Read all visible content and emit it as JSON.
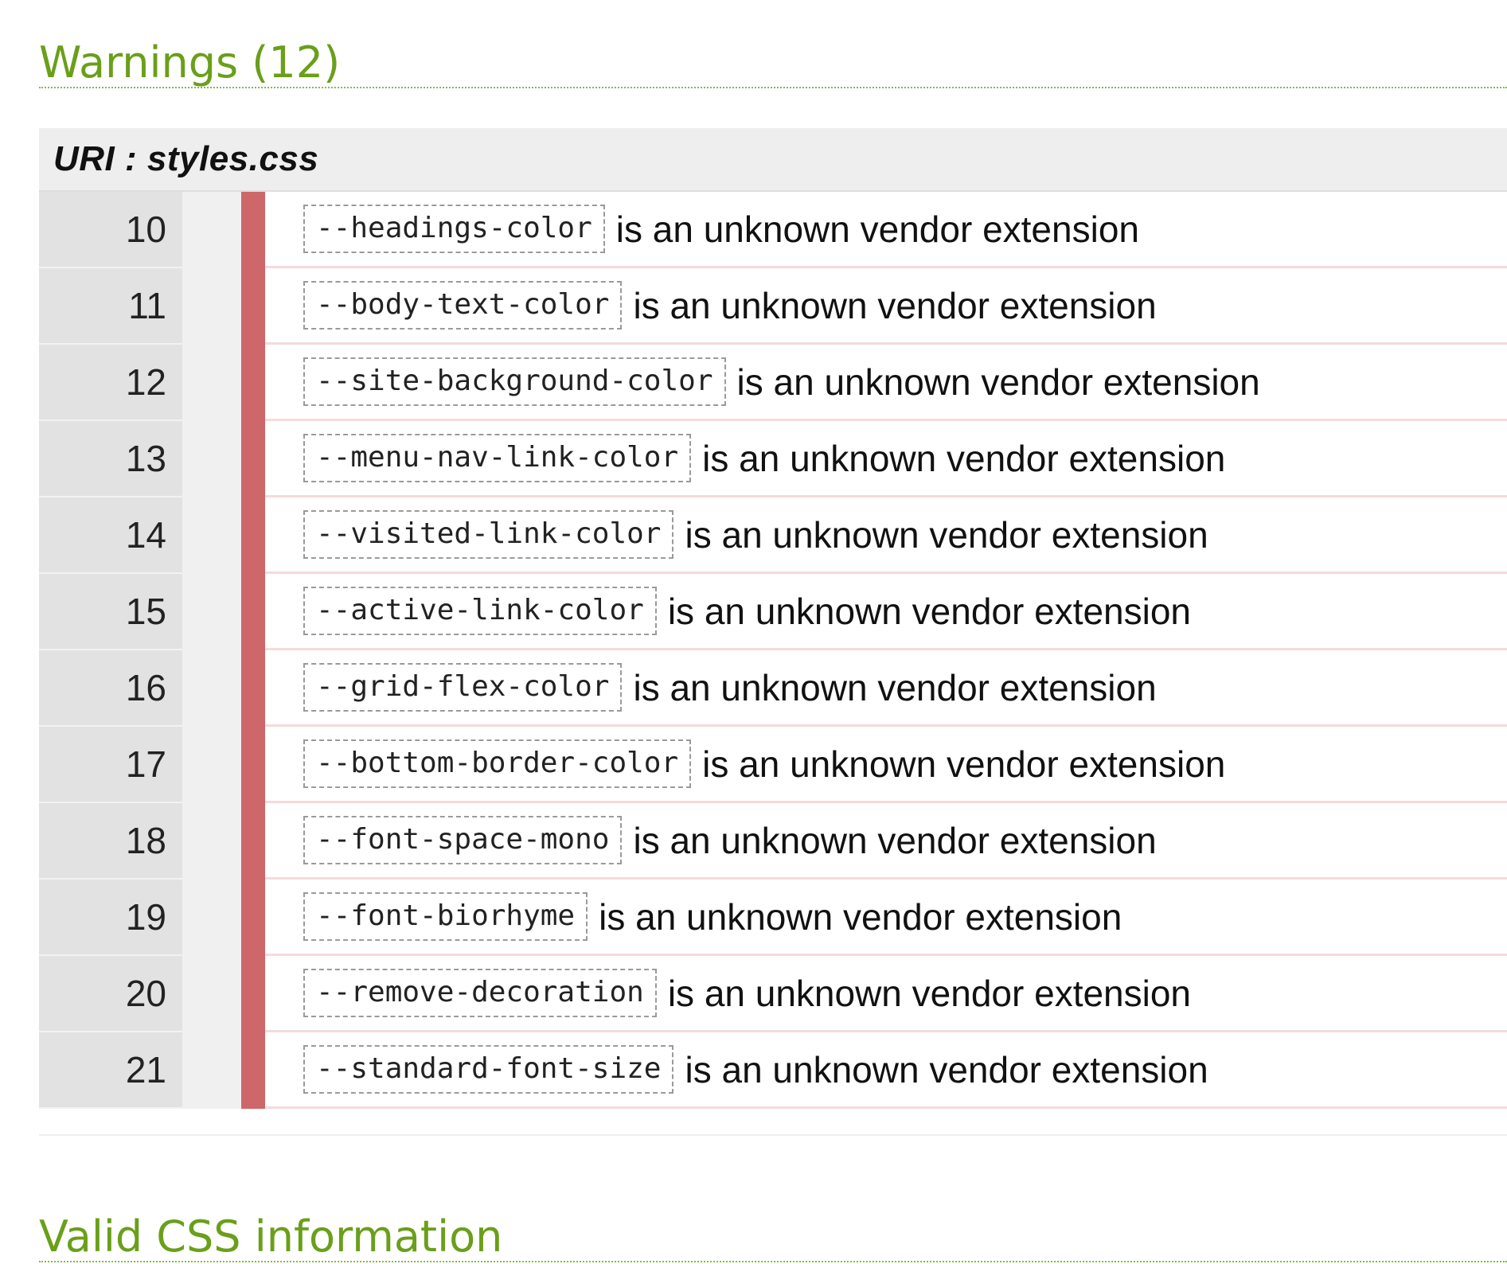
{
  "warnings_heading": "Warnings (12)",
  "uri": {
    "label": "URI",
    "separator": " : ",
    "file": "styles.css"
  },
  "warnings": [
    {
      "line": "10",
      "property": "--headings-color",
      "message": "is an unknown vendor extension"
    },
    {
      "line": "11",
      "property": "--body-text-color",
      "message": "is an unknown vendor extension"
    },
    {
      "line": "12",
      "property": "--site-background-color",
      "message": "is an unknown vendor extension"
    },
    {
      "line": "13",
      "property": "--menu-nav-link-color",
      "message": "is an unknown vendor extension"
    },
    {
      "line": "14",
      "property": "--visited-link-color",
      "message": "is an unknown vendor extension"
    },
    {
      "line": "15",
      "property": "--active-link-color",
      "message": "is an unknown vendor extension"
    },
    {
      "line": "16",
      "property": "--grid-flex-color",
      "message": "is an unknown vendor extension"
    },
    {
      "line": "17",
      "property": "--bottom-border-color",
      "message": "is an unknown vendor extension"
    },
    {
      "line": "18",
      "property": "--font-space-mono",
      "message": "is an unknown vendor extension"
    },
    {
      "line": "19",
      "property": "--font-biorhyme",
      "message": "is an unknown vendor extension"
    },
    {
      "line": "20",
      "property": "--remove-decoration",
      "message": "is an unknown vendor extension"
    },
    {
      "line": "21",
      "property": "--standard-font-size",
      "message": "is an unknown vendor extension"
    }
  ],
  "valid_heading": "Valid CSS information",
  "colors": {
    "heading": "#6a9f1a",
    "warning_marker": "#cd6769",
    "row_divider": "#f7dada"
  }
}
